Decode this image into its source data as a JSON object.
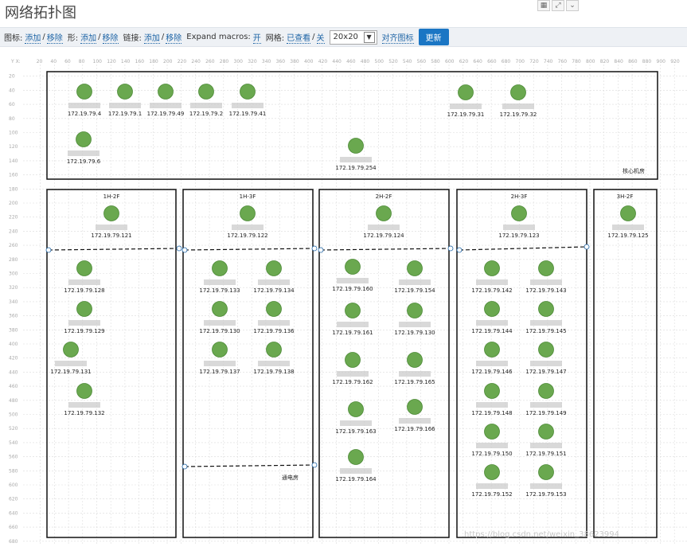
{
  "page": {
    "title": "网络拓扑图"
  },
  "toolbar": {
    "icon_label": "图标:",
    "shape_label": "形:",
    "link_label": "链接:",
    "add": "添加",
    "remove": "移除",
    "slash": "/",
    "expand_macros_label": "Expand macros:",
    "expand_macros_value": "开",
    "grid_label": "网格:",
    "grid_shown": "已查看",
    "grid_off": "关",
    "grid_size": "20x20",
    "align_icons": "对齐图标",
    "update_button": "更新"
  },
  "axis": {
    "corner": "Y X:"
  },
  "rooms": [
    {
      "label": "核心机房"
    },
    {
      "label": "1H-2F"
    },
    {
      "label": "1H-3F"
    },
    {
      "label": "2H-2F"
    },
    {
      "label": "2H-3F"
    },
    {
      "label": "3H-2F"
    },
    {
      "label": "通电房"
    }
  ],
  "hosts": [
    "172.19.79.4",
    "172.19.79.1",
    "172.19.79.49",
    "172.19.79.2",
    "172.19.79.41",
    "172.19.79.31",
    "172.19.79.32",
    "172.19.79.6",
    "172.19.79.254",
    "172.19.79.121",
    "172.19.79.128",
    "172.19.79.129",
    "172.19.79.131",
    "172.19.79.132",
    "172.19.79.122",
    "172.19.79.133",
    "172.19.79.134",
    "172.19.79.130",
    "172.19.79.136",
    "172.19.79.137",
    "172.19.79.138",
    "172.19.79.124",
    "172.19.79.160",
    "172.19.79.154",
    "172.19.79.161",
    "172.19.79.130",
    "172.19.79.162",
    "172.19.79.165",
    "172.19.79.163",
    "172.19.79.166",
    "172.19.79.164",
    "172.19.79.123",
    "172.19.79.142",
    "172.19.79.143",
    "172.19.79.144",
    "172.19.79.145",
    "172.19.79.146",
    "172.19.79.147",
    "172.19.79.148",
    "172.19.79.149",
    "172.19.79.150",
    "172.19.79.151",
    "172.19.79.152",
    "172.19.79.153",
    "172.19.79.125"
  ],
  "colors": {
    "node": "#6aa84f",
    "link": "#1f65a6",
    "button": "#1b76c4"
  },
  "watermark": "https://blog.csdn.net/weixin_38623994"
}
